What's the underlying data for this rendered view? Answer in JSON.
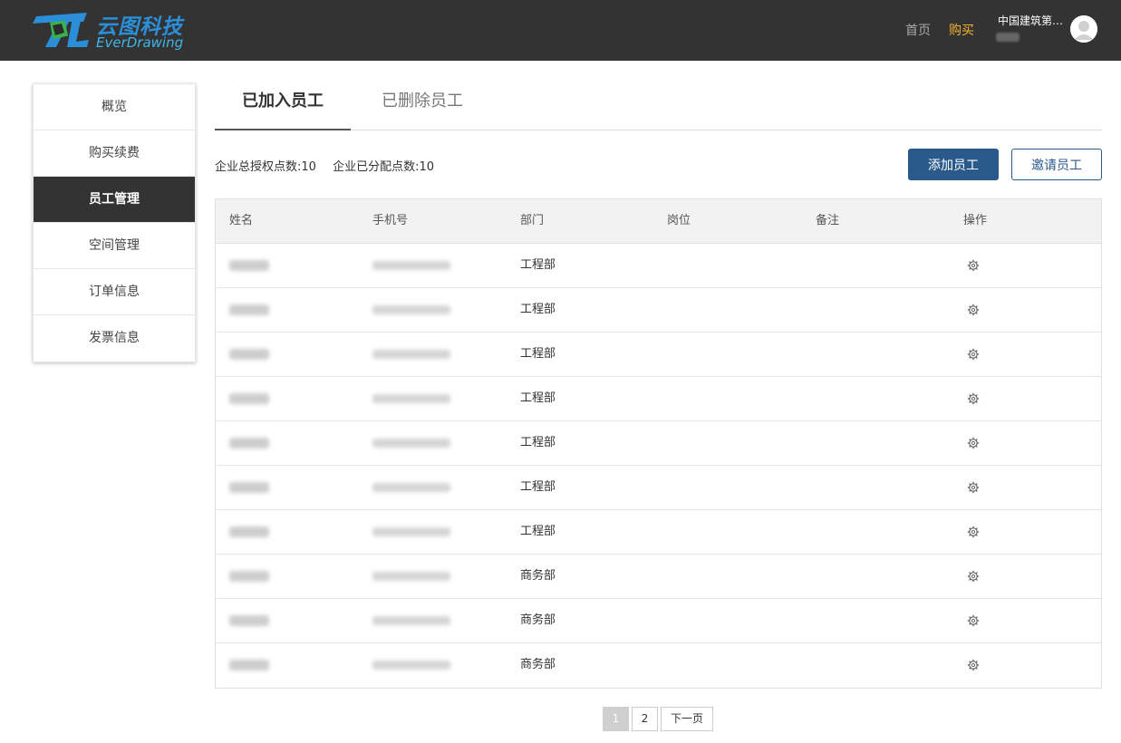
{
  "header": {
    "logo_cn": "云图科技",
    "logo_en": "EverDrawing",
    "nav_home": "首页",
    "nav_buy": "购买",
    "user_name": "中国建筑第…"
  },
  "sidebar": {
    "items": [
      {
        "label": "概览"
      },
      {
        "label": "购买续费"
      },
      {
        "label": "员工管理"
      },
      {
        "label": "空间管理"
      },
      {
        "label": "订单信息"
      },
      {
        "label": "发票信息"
      }
    ],
    "active": "员工管理"
  },
  "tabs": [
    {
      "label": "已加入员工"
    },
    {
      "label": "已删除员工"
    }
  ],
  "summary": {
    "total_auth": "企业总授权点数:10",
    "allocated": "企业已分配点数:10"
  },
  "buttons": {
    "add": "添加员工",
    "invite": "邀请员工"
  },
  "table": {
    "columns": [
      "姓名",
      "手机号",
      "部门",
      "岗位",
      "备注",
      "操作"
    ],
    "rows": [
      {
        "dept": "工程部"
      },
      {
        "dept": "工程部"
      },
      {
        "dept": "工程部"
      },
      {
        "dept": "工程部"
      },
      {
        "dept": "工程部"
      },
      {
        "dept": "工程部"
      },
      {
        "dept": "工程部"
      },
      {
        "dept": "商务部"
      },
      {
        "dept": "商务部"
      },
      {
        "dept": "商务部"
      }
    ]
  },
  "pagination": {
    "page1": "1",
    "page2": "2",
    "next": "下一页",
    "current": 1
  },
  "colors": {
    "header_bg": "#333333",
    "accent_buy": "#f2b32e",
    "primary_button": "#2a5a8c",
    "active_sidebar": "#333333"
  },
  "icons": [
    "logo-mark-icon",
    "avatar-icon",
    "gear-icon"
  ]
}
